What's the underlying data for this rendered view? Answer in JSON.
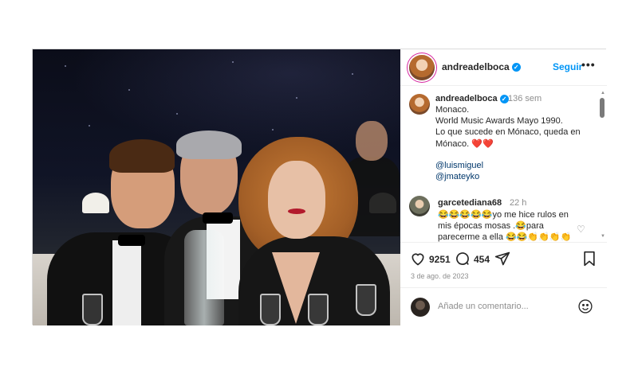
{
  "post": {
    "username": "andreadelboca",
    "follow_label": "Seguir",
    "more_label": "•••",
    "caption": {
      "username": "andreadelboca",
      "time": "136 sem",
      "lines": [
        "Monaco.",
        "World Music Awards Mayo 1990.",
        "Lo que sucede en Mónaco, queda en",
        "Mónaco. ❤️❤️"
      ],
      "mentions": [
        "@luismiguel",
        "@jmateyko"
      ]
    },
    "comment": {
      "username": "garcetediana68",
      "time": "22 h",
      "lines": [
        "😂😂😂😂😂yo me hice rulos en",
        "mis épocas mosas .😂para",
        "parecerme a ella 😂😂👏👏👏👏"
      ]
    },
    "likes": "9251",
    "comments_count": "454",
    "date": "3 de ago. de 2023",
    "add_comment_placeholder": "Añade un comentario..."
  },
  "icons": {
    "verified": "verified-badge-icon",
    "like": "heart-icon",
    "comment": "comment-bubble-icon",
    "share": "send-plane-icon",
    "save": "bookmark-icon",
    "emoji": "smiley-icon"
  },
  "colors": {
    "accent": "#0095f6",
    "text": "#262626",
    "muted": "#8e8e8e",
    "mention": "#00376b"
  }
}
